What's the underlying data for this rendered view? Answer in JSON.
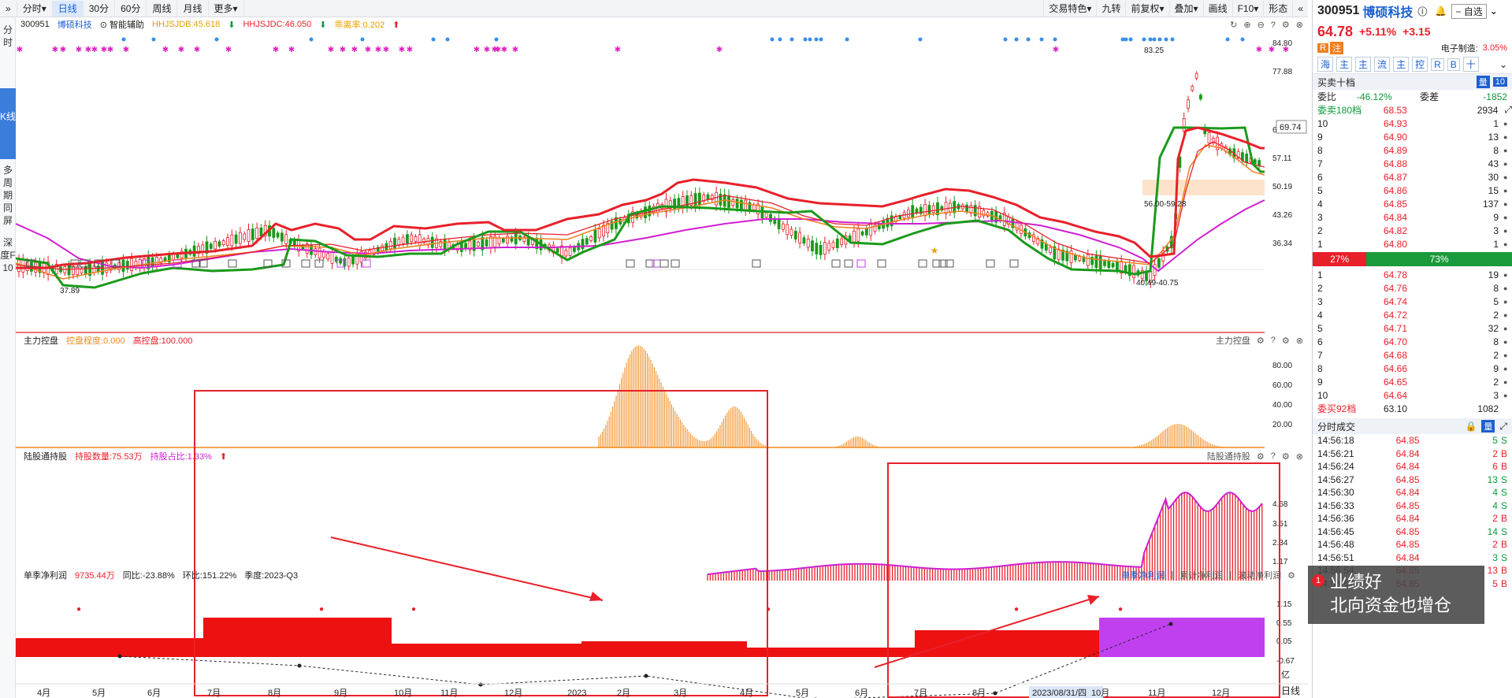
{
  "toolbar": {
    "left": [
      "分时",
      "日线",
      "30分",
      "60分",
      "周线",
      "月线",
      "更多"
    ],
    "active": "日线",
    "right": [
      "交易特色",
      "九转",
      "前复权",
      "叠加",
      "画线",
      "F10",
      "形态"
    ]
  },
  "left_strip": {
    "items": [
      "分时",
      "K线",
      "多周期同屏",
      "深度F10"
    ]
  },
  "kline_panel": {
    "code": "300951",
    "name": "博硕科技",
    "assist": "智能辅助",
    "ind1": "HHJSJDB:45.618",
    "ind2": "HHJSJDC:46.050",
    "ind3": "乖离率:0.202",
    "y_ticks": [
      "84.80",
      "77.88",
      "69.74",
      "64.03",
      "57.11",
      "50.19",
      "43.26",
      "36.34"
    ],
    "annot_high": "83.25",
    "annot_low": "37.89",
    "annot_low2": "40.49-40.75",
    "annot_zone": "56.00-59.28",
    "current_tag": "69.74"
  },
  "control_panel": {
    "title": "主力控盘",
    "ind1": "控盘程度:0.000",
    "ind2": "高控盘:100.000",
    "right_label": "主力控盘",
    "y_ticks": [
      "80.00",
      "60.00",
      "40.00",
      "20.00"
    ]
  },
  "hk_panel": {
    "title": "陆股通持股",
    "ind1": "持股数量:75.53万",
    "ind2": "持股占比:1.33%",
    "right_label": "陆股通持股",
    "y_ticks": [
      "4.68",
      "3.51",
      "2.34",
      "1.17"
    ]
  },
  "profit_panel": {
    "title": "单季净利润",
    "value": "9735.44万",
    "yoy": "同比:-23.88%",
    "qoq": "环比:151.22%",
    "season": "季度:2023-Q3",
    "tabs": [
      "单季净利润",
      "累计净利润",
      "滚动净利润"
    ],
    "y_ticks": [
      "1.15",
      "0.55",
      "0.05",
      "-0.67"
    ],
    "unit": "亿"
  },
  "x_axis": {
    "labels": [
      "4月",
      "5月",
      "6月",
      "7月",
      "8月",
      "9月",
      "10月",
      "11月",
      "12月",
      "2023",
      "2月",
      "3月",
      "4月",
      "5月",
      "6月",
      "7月",
      "8月",
      "2023/08/31/四",
      "10月",
      "11月",
      "12月"
    ],
    "period": "日线"
  },
  "quote": {
    "code": "300951",
    "name": "博硕科技",
    "price": "64.78",
    "pct": "+5.11%",
    "change": "+3.15",
    "watch": "自选",
    "tag_r": "R",
    "tag_rong": "注",
    "industry": "电子制造:",
    "industry_pct": "3.05%",
    "quick_tabs": [
      "海",
      "主",
      "主",
      "流",
      "主",
      "控",
      "R",
      "B",
      "十"
    ]
  },
  "orderbook": {
    "title": "买卖十档",
    "wei_bi_label": "委比",
    "wei_bi": "-46.12%",
    "wei_cha_label": "委差",
    "wei_cha": "-1852",
    "sell_sum_label": "委卖180档",
    "sell_sum_price": "68.53",
    "sell_sum_vol": "2934",
    "sells": [
      {
        "lv": "10",
        "p": "64.93",
        "v": "1"
      },
      {
        "lv": "9",
        "p": "64.90",
        "v": "13"
      },
      {
        "lv": "8",
        "p": "64.89",
        "v": "8"
      },
      {
        "lv": "7",
        "p": "64.88",
        "v": "43"
      },
      {
        "lv": "6",
        "p": "64.87",
        "v": "30"
      },
      {
        "lv": "5",
        "p": "64.86",
        "v": "15"
      },
      {
        "lv": "4",
        "p": "64.85",
        "v": "137"
      },
      {
        "lv": "3",
        "p": "64.84",
        "v": "9"
      },
      {
        "lv": "2",
        "p": "64.82",
        "v": "3"
      },
      {
        "lv": "1",
        "p": "64.80",
        "v": "1"
      }
    ],
    "ratio_sell": "27%",
    "ratio_buy": "73%",
    "ratio_sell_frac": 0.27,
    "buys": [
      {
        "lv": "1",
        "p": "64.78",
        "v": "19"
      },
      {
        "lv": "2",
        "p": "64.76",
        "v": "8"
      },
      {
        "lv": "3",
        "p": "64.74",
        "v": "5"
      },
      {
        "lv": "4",
        "p": "64.72",
        "v": "2"
      },
      {
        "lv": "5",
        "p": "64.71",
        "v": "32"
      },
      {
        "lv": "6",
        "p": "64.70",
        "v": "8"
      },
      {
        "lv": "7",
        "p": "64.68",
        "v": "2"
      },
      {
        "lv": "8",
        "p": "64.66",
        "v": "9"
      },
      {
        "lv": "9",
        "p": "64.65",
        "v": "2"
      },
      {
        "lv": "10",
        "p": "64.64",
        "v": "3"
      }
    ],
    "buy_sum_label": "委买92档",
    "buy_sum_price": "63.10",
    "buy_sum_vol": "1082"
  },
  "trades": {
    "title": "分时成交",
    "rows": [
      {
        "t": "14:56:18",
        "p": "64.85",
        "v": "5",
        "s": "S"
      },
      {
        "t": "14:56:21",
        "p": "64.84",
        "v": "2",
        "s": "B"
      },
      {
        "t": "14:56:24",
        "p": "64.84",
        "v": "6",
        "s": "B"
      },
      {
        "t": "14:56:27",
        "p": "64.85",
        "v": "13",
        "s": "S"
      },
      {
        "t": "14:56:30",
        "p": "64.84",
        "v": "4",
        "s": "S"
      },
      {
        "t": "14:56:33",
        "p": "64.85",
        "v": "4",
        "s": "S"
      },
      {
        "t": "14:56:36",
        "p": "64.84",
        "v": "2",
        "s": "B"
      },
      {
        "t": "14:56:45",
        "p": "64.85",
        "v": "14",
        "s": "S"
      },
      {
        "t": "14:56:48",
        "p": "64.85",
        "v": "2",
        "s": "B"
      },
      {
        "t": "14:56:51",
        "p": "64.84",
        "v": "3",
        "s": "S"
      },
      {
        "t": "14:56:54",
        "p": "64.85",
        "v": "13",
        "s": "B"
      },
      {
        "t": "14:56:57",
        "p": "64.85",
        "v": "5",
        "s": "B"
      }
    ]
  },
  "overlay": {
    "badge": "1",
    "line1": "业绩好",
    "line2": "北向资金也增仓"
  },
  "colors": {
    "up": "#e8202a",
    "down": "#0a9a3a",
    "accent": "#1c5fd1",
    "ma_red": "#e8202a",
    "ma_green": "#1a9a1a",
    "ma_magenta": "#d020d0",
    "ma_orange": "#f08020",
    "control_bar": "#f08a1c",
    "purple": "#c040f0"
  }
}
